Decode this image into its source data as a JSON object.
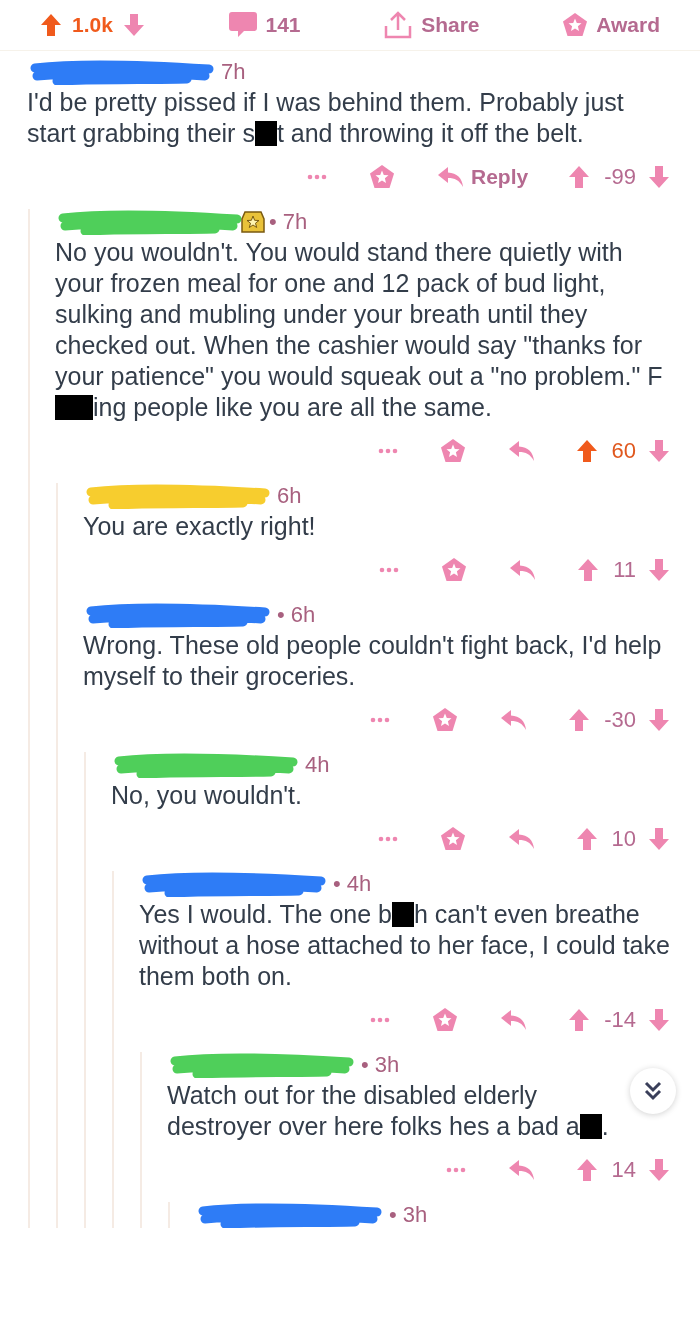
{
  "post_bar": {
    "score": "1.0k",
    "upvoted": true,
    "comments": "141",
    "share": "Share",
    "award": "Award"
  },
  "comments": [
    {
      "color": "#2e7cf6",
      "time": "7h",
      "award_badge": false,
      "body": [
        {
          "kind": "text",
          "text": "I'd be pretty pissed if I was behind them. Probably just start grabbing their s"
        },
        {
          "kind": "redaction"
        },
        {
          "kind": "text",
          "text": "t and throwing it off the belt."
        }
      ],
      "award_button": true,
      "reply_label": "Reply",
      "upvoted": false,
      "score": "-99",
      "replies": [
        {
          "color": "#4fcf5a",
          "time": "• 7h",
          "award_badge": true,
          "body": [
            {
              "kind": "text",
              "text": "No you wouldn't.  You would stand there quietly with your frozen meal for one and 12 pack of bud light, sulking and mubling under your breath until they checked out.  When the cashier would say \"thanks for your patience\" you would squeak out a \"no problem.\"  F"
            },
            {
              "kind": "redaction"
            },
            {
              "kind": "text",
              "text": "ing people like you are all the same."
            }
          ],
          "award_button": true,
          "upvoted": true,
          "score": "60",
          "replies": [
            {
              "color": "#f7cd2e",
              "time": "6h",
              "award_badge": false,
              "body": [
                {
                  "kind": "text",
                  "text": "You are exactly right!"
                }
              ],
              "award_button": true,
              "upvoted": false,
              "score": "11"
            },
            {
              "color": "#2e7cf6",
              "time": "• 6h",
              "award_badge": false,
              "body": [
                {
                  "kind": "text",
                  "text": "Wrong. These old people couldn't fight back, I'd help myself to their groceries."
                }
              ],
              "award_button": true,
              "upvoted": false,
              "score": "-30",
              "replies": [
                {
                  "color": "#4fcf5a",
                  "time": "4h",
                  "award_badge": false,
                  "body": [
                    {
                      "kind": "text",
                      "text": "No, you wouldn't."
                    }
                  ],
                  "award_button": true,
                  "upvoted": false,
                  "score": "10",
                  "replies": [
                    {
                      "color": "#2e7cf6",
                      "time": "• 4h",
                      "award_badge": false,
                      "body": [
                        {
                          "kind": "text",
                          "text": "Yes I would. The one b"
                        },
                        {
                          "kind": "redaction"
                        },
                        {
                          "kind": "text",
                          "text": "h can't even breathe without a hose attached to her face, I could take them both on."
                        }
                      ],
                      "award_button": true,
                      "upvoted": false,
                      "score": "-14",
                      "replies": [
                        {
                          "color": "#4fcf5a",
                          "time": "• 3h",
                          "award_badge": false,
                          "scroll_button": true,
                          "body": [
                            {
                              "kind": "text",
                              "text": "Watch out for the disabled elderly destroyer over here folks hes a bad a"
                            },
                            {
                              "kind": "redaction"
                            },
                            {
                              "kind": "text",
                              "text": "."
                            }
                          ],
                          "award_button": false,
                          "upvoted": false,
                          "score": "14",
                          "replies": [
                            {
                              "color": "#2e7cf6",
                              "time": "• 3h",
                              "award_badge": false
                            }
                          ]
                        }
                      ]
                    }
                  ]
                }
              ]
            }
          ]
        }
      ]
    }
  ]
}
